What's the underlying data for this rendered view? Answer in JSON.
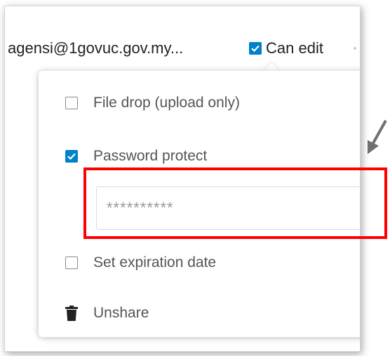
{
  "share": {
    "email": "agensi@1govuc.gov.my...",
    "can_edit_label": "Can edit",
    "can_edit_checked": true
  },
  "menu": {
    "file_drop_label": "File drop (upload only)",
    "file_drop_checked": false,
    "password_label": "Password protect",
    "password_checked": true,
    "password_value": "**********",
    "expiration_label": "Set expiration date",
    "expiration_checked": false,
    "unshare_label": "Unshare"
  },
  "icons": {
    "checkbox_checked": "check-icon",
    "unshare": "trash-icon",
    "annotation": "arrow-icon"
  },
  "colors": {
    "accent": "#0082c9",
    "highlight": "#ff0000",
    "arrow": "#707070"
  }
}
